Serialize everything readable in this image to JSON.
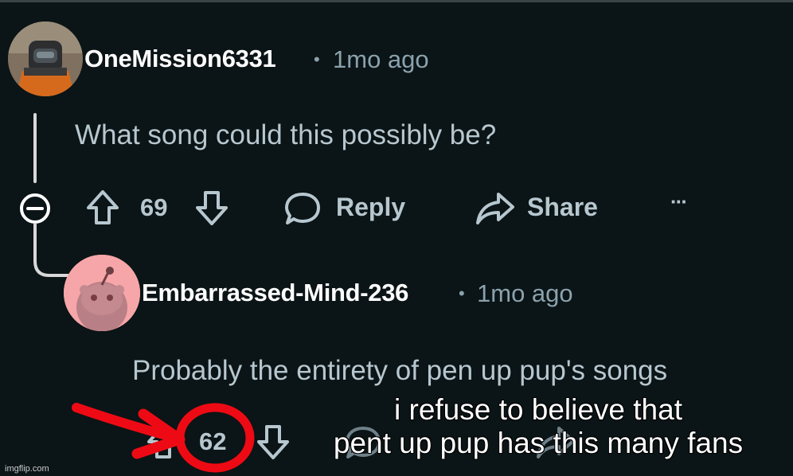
{
  "comment1": {
    "username": "OneMission6331",
    "separator": "•",
    "time": "1mo ago",
    "body": "What song could this possibly be?",
    "upvotes": "69",
    "reply_label": "Reply",
    "share_label": "Share",
    "more_label": "···"
  },
  "comment2": {
    "username": "Embarrassed-Mind-236",
    "separator": "•",
    "time": "1mo ago",
    "body": "Probably the entirety of pen up pup's songs",
    "upvotes": "62"
  },
  "overlay": {
    "line1": "i refuse to believe that",
    "line2": "pent up pup has this many fans"
  },
  "watermark": "imgflip.com",
  "colors": {
    "background": "#0b1416",
    "annotation_red": "#ee0a14",
    "avatar2_bg": "#f6a6a8"
  }
}
